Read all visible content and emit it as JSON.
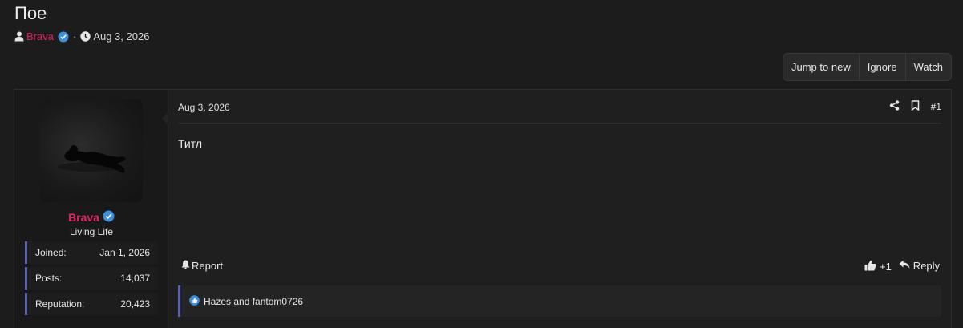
{
  "thread": {
    "title": "Пое",
    "author": "Brava",
    "date": "Aug 3, 2026"
  },
  "toolbar": {
    "jump_label": "Jump to new",
    "ignore_label": "Ignore",
    "watch_label": "Watch"
  },
  "post": {
    "date": "Aug 3, 2026",
    "number": "#1",
    "body": "Титл",
    "report_label": "Report",
    "reaction_count": "+1",
    "reply_label": "Reply",
    "reactions_text": "Hazes and fantom0726"
  },
  "user": {
    "name": "Brava",
    "title": "Living Life",
    "stats": [
      {
        "label": "Joined:",
        "value": "Jan 1, 2026"
      },
      {
        "label": "Posts:",
        "value": "14,037"
      },
      {
        "label": "Reputation:",
        "value": "20,423"
      }
    ]
  },
  "colors": {
    "username": "#e0245e",
    "accent_border": "#5a62b8",
    "verified": "#3d8fe0"
  }
}
